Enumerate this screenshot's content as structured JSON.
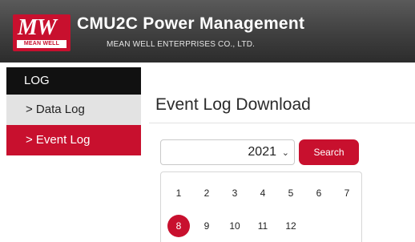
{
  "header": {
    "logo_mark": "MW",
    "logo_text": "MEAN WELL",
    "title": "CMU2C Power Management",
    "company": "MEAN WELL ENTERPRISES CO., LTD."
  },
  "sidebar": {
    "heading": "LOG",
    "items": [
      {
        "label": "> Data Log",
        "active": false
      },
      {
        "label": "> Event Log",
        "active": true
      }
    ]
  },
  "main": {
    "title": "Event Log Download",
    "year_select": {
      "value": "2021"
    },
    "search_label": "Search",
    "months": [
      "1",
      "2",
      "3",
      "4",
      "5",
      "6",
      "7",
      "8",
      "9",
      "10",
      "11",
      "12"
    ],
    "selected_month": "8"
  },
  "colors": {
    "accent": "#c8102e",
    "header_bg": "#3f3f3f",
    "sidebar_heading_bg": "#111111",
    "sidebar_item_bg": "#e3e3e3"
  }
}
